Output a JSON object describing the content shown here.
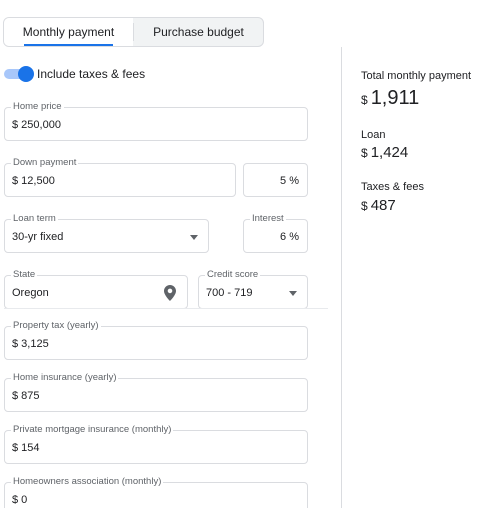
{
  "tabs": [
    {
      "label": "Monthly payment",
      "active": true
    },
    {
      "label": "Purchase budget",
      "active": false
    }
  ],
  "toggle": {
    "label": "Include taxes & fees",
    "on": true
  },
  "fields": {
    "home_price": {
      "label": "Home price",
      "value": "$ 250,000"
    },
    "down_payment": {
      "label": "Down payment",
      "value": "$ 12,500"
    },
    "down_percent": {
      "value": "5 %"
    },
    "loan_term": {
      "label": "Loan term",
      "value": "30-yr fixed"
    },
    "interest": {
      "label": "Interest",
      "value": "6 %"
    },
    "state": {
      "label": "State",
      "value": "Oregon"
    },
    "credit_score": {
      "label": "Credit score",
      "value": "700 - 719"
    },
    "property_tax": {
      "label": "Property tax (yearly)",
      "value": "$ 3,125"
    },
    "home_insurance": {
      "label": "Home insurance (yearly)",
      "value": "$ 875"
    },
    "pmi": {
      "label": "Private mortgage insurance (monthly)",
      "value": "$ 154"
    },
    "hoa": {
      "label": "Homeowners association (monthly)",
      "value": "$ 0"
    }
  },
  "summary": {
    "total_label": "Total monthly payment",
    "total_currency": "$",
    "total_value": "1,911",
    "loan_label": "Loan",
    "loan_currency": "$",
    "loan_value": "1,424",
    "taxes_label": "Taxes & fees",
    "taxes_currency": "$",
    "taxes_value": "487"
  },
  "colors": {
    "accent": "#1a73e8",
    "toggle_track": "#a8c7fa",
    "border": "#dadce0"
  },
  "icons": {
    "location": "location-pin-icon",
    "dropdown": "chevron-down-icon"
  }
}
